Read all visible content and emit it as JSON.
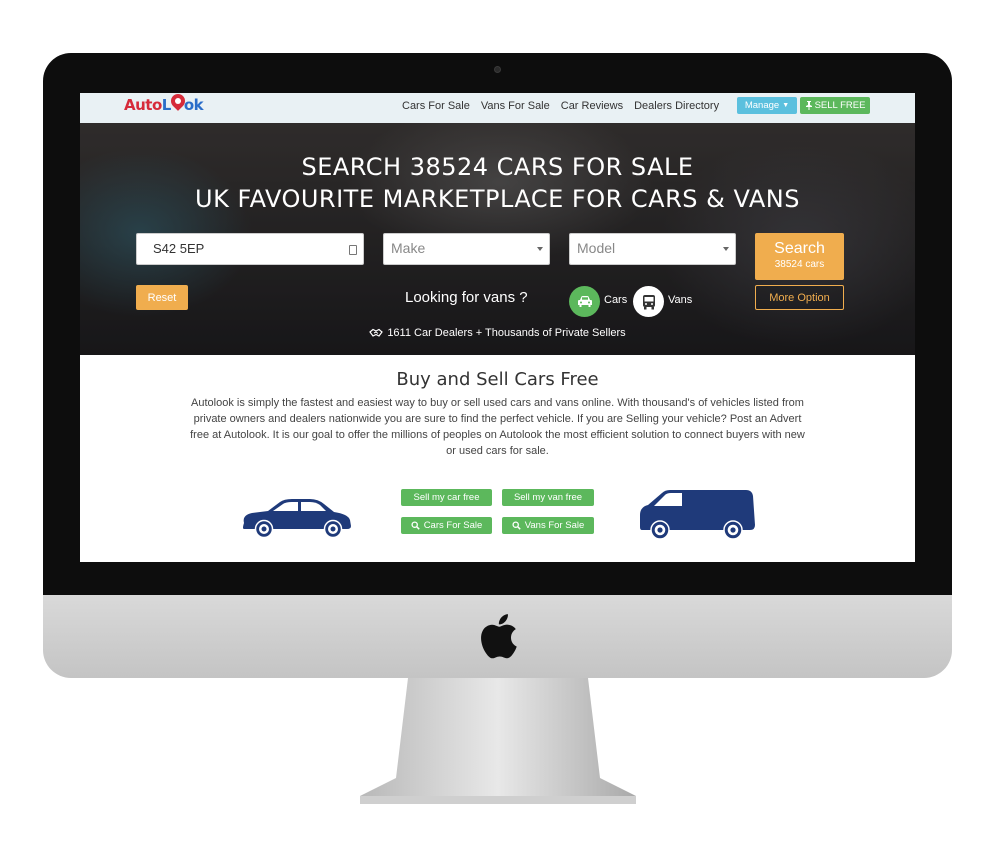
{
  "brand": {
    "logo_text_1": "Auto",
    "logo_text_2": "L",
    "logo_text_3": "ok",
    "red": "#d62b3a",
    "blue": "#2a6dc9"
  },
  "nav": {
    "links": [
      "Cars For Sale",
      "Vans For Sale",
      "Car Reviews",
      "Dealers Directory"
    ],
    "manage_label": "Manage",
    "sell_label": "SELL FREE"
  },
  "hero": {
    "title_line1": "SEARCH 38524 CARS FOR SALE",
    "title_line2": "UK FAVOURITE MARKETPLACE FOR CARS & VANS",
    "postcode_value": "S42 5EP",
    "make_selected": "Make",
    "model_selected": "Model",
    "search_label": "Search",
    "search_count": "38524 cars",
    "reset_label": "Reset",
    "more_option_label": "More Option",
    "looking_for": "Looking for vans ?",
    "toggle_cars_label": "Cars",
    "toggle_vans_label": "Vans",
    "dealers_text": "1611 Car Dealers + Thousands of Private Sellers"
  },
  "content": {
    "title": "Buy and Sell Cars Free",
    "paragraph": "Autolook is simply the fastest and easiest way to buy or sell used cars and vans online. With thousand's of vehicles listed from private owners and dealers nationwide you are sure to find the perfect vehicle. If you are Selling your vehicle? Post an Advert free at Autolook. It is our goal to offer the millions of peoples on Autolook the most efficient solution to connect buyers with new or used cars for sale.",
    "sell_car_label": "Sell my car free",
    "sell_van_label": "Sell my van free",
    "cars_for_sale_label": "Cars For Sale",
    "vans_for_sale_label": "Vans For Sale"
  },
  "colors": {
    "orange": "#f0ad4e",
    "green": "#5cb85c",
    "info": "#5bc0de",
    "vehicle_navy": "#1f3a7a"
  }
}
